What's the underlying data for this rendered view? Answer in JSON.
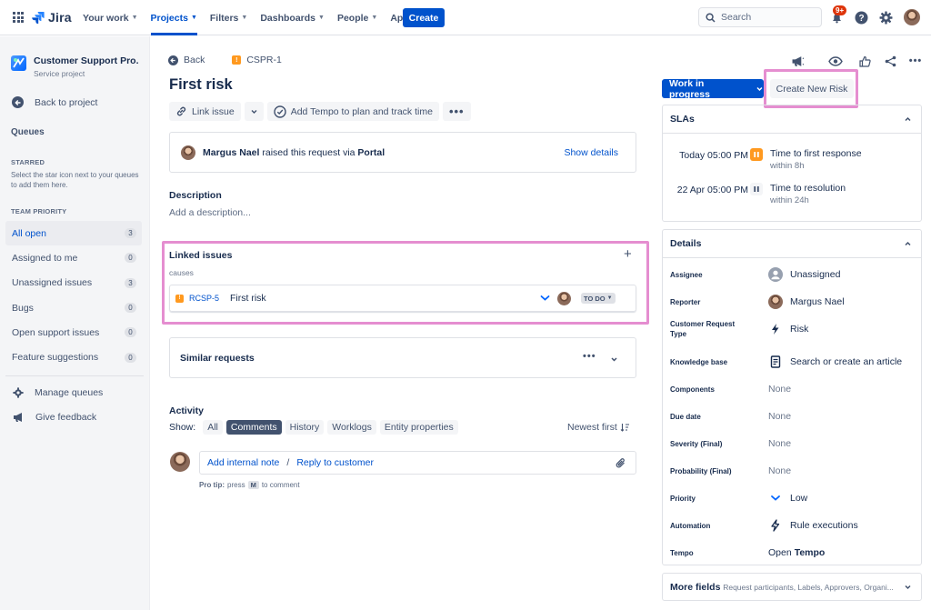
{
  "topnav": {
    "brand": "Jira",
    "items": [
      {
        "label": "Your work"
      },
      {
        "label": "Projects"
      },
      {
        "label": "Filters"
      },
      {
        "label": "Dashboards"
      },
      {
        "label": "People"
      },
      {
        "label": "Apps"
      }
    ],
    "create_label": "Create",
    "search_placeholder": "Search",
    "notification_count": "9+"
  },
  "sidebar": {
    "project_name": "Customer Support Pro...",
    "project_type": "Service project",
    "back_label": "Back to project",
    "queues_heading": "Queues",
    "starred_heading": "STARRED",
    "starred_hint": "Select the star icon next to your queues to add them here.",
    "team_priority_heading": "TEAM PRIORITY",
    "queues": [
      {
        "label": "All open",
        "count": "3"
      },
      {
        "label": "Assigned to me",
        "count": "0"
      },
      {
        "label": "Unassigned issues",
        "count": "3"
      },
      {
        "label": "Bugs",
        "count": "0"
      },
      {
        "label": "Open support issues",
        "count": "0"
      },
      {
        "label": "Feature suggestions",
        "count": "0"
      }
    ],
    "manage_label": "Manage queues",
    "feedback_label": "Give feedback"
  },
  "issue": {
    "back_label": "Back",
    "key": "CSPR-1",
    "title": "First risk",
    "link_issue_label": "Link issue",
    "tempo_label": "Add Tempo to plan and track time",
    "requester": "Margus Nael",
    "request_text": "raised this request via",
    "channel": "Portal",
    "show_details": "Show details",
    "description_heading": "Description",
    "description_placeholder": "Add a description...",
    "linked_heading": "Linked issues",
    "link_type": "causes",
    "linked": {
      "key": "RCSP-5",
      "summary": "First risk",
      "status": "TO DO"
    },
    "similar_heading": "Similar requests",
    "activity_heading": "Activity",
    "show_label": "Show:",
    "filters": [
      "All",
      "Comments",
      "History",
      "Worklogs",
      "Entity properties"
    ],
    "sort_label": "Newest first",
    "internal_note": "Add internal note",
    "sep": "/",
    "reply": "Reply to customer",
    "protip_prefix": "Pro tip:",
    "protip_press": "press",
    "protip_key": "M",
    "protip_suffix": "to comment"
  },
  "right": {
    "status_label": "Work in progress",
    "create_risk_label": "Create New Risk",
    "slas_heading": "SLAs",
    "slas": [
      {
        "time": "Today 05:00 PM",
        "name": "Time to first response",
        "sub": "within 8h",
        "color": "#ff991f"
      },
      {
        "time": "22 Apr 05:00 PM",
        "name": "Time to resolution",
        "sub": "within 24h",
        "color": "#dfe1e6"
      }
    ],
    "details_heading": "Details",
    "details": [
      {
        "label": "Assignee",
        "value": "Unassigned"
      },
      {
        "label": "Reporter",
        "value": "Margus Nael"
      },
      {
        "label": "Customer Request Type",
        "value": "Risk"
      },
      {
        "label": "Knowledge base",
        "value": "Search or create an article"
      },
      {
        "label": "Components",
        "value": "None"
      },
      {
        "label": "Due date",
        "value": "None"
      },
      {
        "label": "Severity (Final)",
        "value": "None"
      },
      {
        "label": "Probability (Final)",
        "value": "None"
      },
      {
        "label": "Priority",
        "value": "Low"
      },
      {
        "label": "Automation",
        "value": "Rule executions"
      },
      {
        "label": "Tempo",
        "value_prefix": "Open",
        "value": "Tempo"
      }
    ],
    "more_fields": "More fields",
    "more_fields_sub": "Request participants, Labels, Approvers, Organi..."
  },
  "colors": {
    "accent": "#0052cc",
    "highlight": "#e58ed0",
    "warning": "#ff991f"
  }
}
